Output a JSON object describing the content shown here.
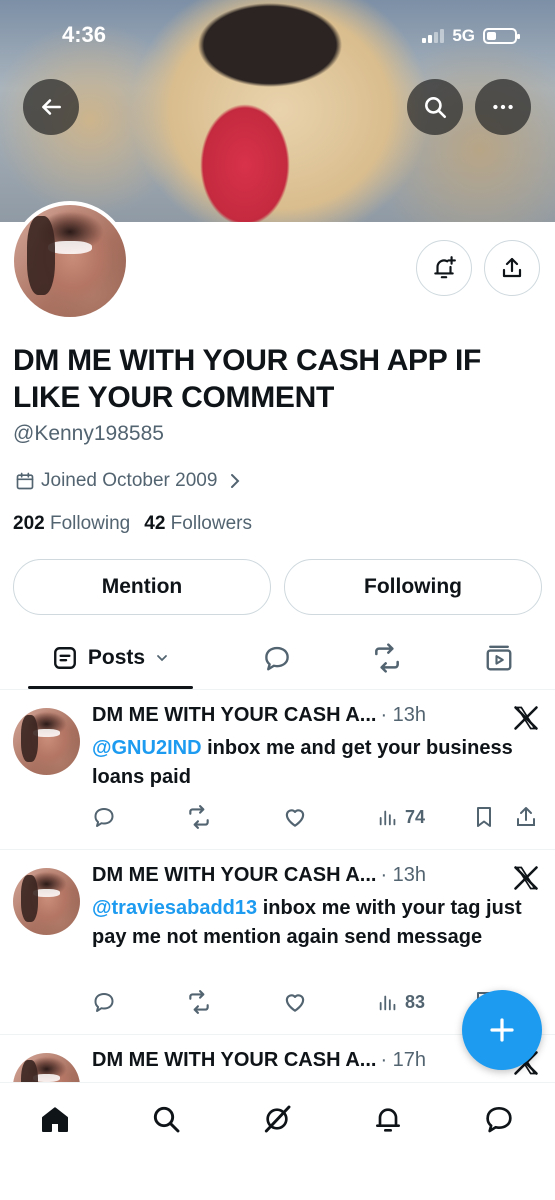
{
  "status_bar": {
    "time": "4:36",
    "network": "5G"
  },
  "profile": {
    "display_name": "DM ME WITH YOUR CASH APP IF LIKE YOUR COMMENT",
    "handle": "@Kenny198585",
    "joined": "Joined October 2009",
    "following_count": "202",
    "following_label": "Following",
    "followers_count": "42",
    "followers_label": "Followers"
  },
  "buttons": {
    "mention": "Mention",
    "following": "Following"
  },
  "tabs": {
    "posts_label": "Posts"
  },
  "posts": [
    {
      "name": "DM ME WITH YOUR CASH A...",
      "time": "· 13h",
      "mention": "@GNU2IND",
      "text": " inbox me and get your business loans paid",
      "views": "74"
    },
    {
      "name": "DM ME WITH YOUR CASH A...",
      "time": "· 13h",
      "mention": "@traviesabadd13",
      "text": " inbox me with your tag just pay me not mention again send message",
      "views": "83"
    },
    {
      "name": "DM ME WITH YOUR CASH A...",
      "time": "· 17h"
    }
  ],
  "icons": {
    "back": "arrow-left-icon",
    "search": "search-icon",
    "more": "more-dots-icon",
    "notify": "bell-plus-icon",
    "share": "share-icon",
    "brand": "x-logo-icon"
  },
  "colors": {
    "accent": "#1d9bf0",
    "text": "#0f1419",
    "muted": "#536471",
    "border": "#cfd9de"
  }
}
